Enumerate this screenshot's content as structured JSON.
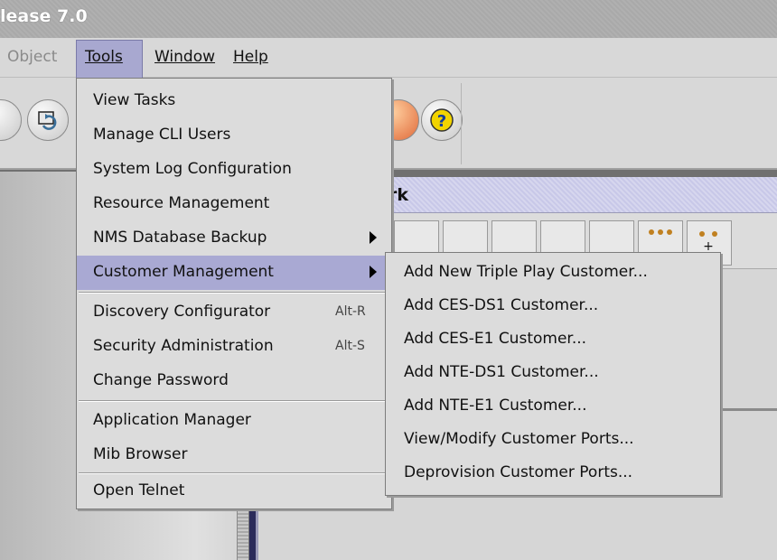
{
  "window": {
    "title": "lease 7.0"
  },
  "menubar": {
    "object": "Object",
    "tools": "Tools",
    "window": "Window",
    "help": "Help"
  },
  "panel": {
    "title_fragment": "rk"
  },
  "tools_menu": {
    "items": [
      {
        "label": "View Tasks"
      },
      {
        "label": "Manage CLI Users"
      },
      {
        "label": "System Log Configuration"
      },
      {
        "label": "Resource Management"
      },
      {
        "label": "NMS Database Backup",
        "submenu": true
      },
      {
        "label": "Customer Management",
        "submenu": true,
        "active": true
      },
      {
        "label": "Discovery Configurator",
        "accelerator": "Alt-R"
      },
      {
        "label": "Security Administration",
        "accelerator": "Alt-S"
      },
      {
        "label": "Change Password"
      },
      {
        "label": "Application Manager"
      },
      {
        "label": "Mib Browser"
      },
      {
        "label": "Open Telnet"
      }
    ]
  },
  "customer_submenu": {
    "items": [
      {
        "label": "Add New Triple Play Customer..."
      },
      {
        "label": "Add CES-DS1 Customer..."
      },
      {
        "label": "Add CES-E1 Customer..."
      },
      {
        "label": "Add NTE-DS1 Customer..."
      },
      {
        "label": "Add NTE-E1 Customer..."
      },
      {
        "label": "View/Modify Customer Ports..."
      },
      {
        "label": "Deprovision Customer Ports..."
      }
    ]
  },
  "colors": {
    "menu_highlight": "#a9a9d3",
    "panel_title_bg": "#c8c8e8"
  },
  "icons": [
    "refresh-icon",
    "help-icon",
    "cluster-icon",
    "add-node-icon"
  ]
}
